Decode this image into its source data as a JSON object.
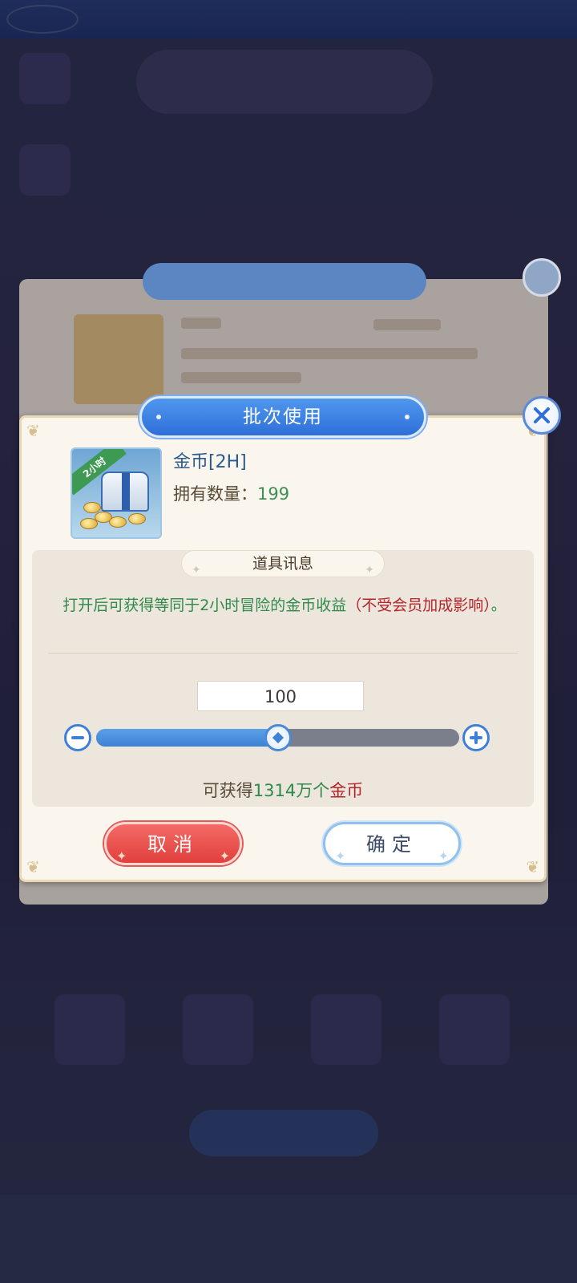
{
  "dialog": {
    "title": "批次使用",
    "item_name": "金币[2H]",
    "count_label": "拥有数量：",
    "count_value": "199",
    "item_badge": "2小时",
    "info_header": "道具讯息",
    "description_green": "打开后可获得等同于2小时冒险的金币收益",
    "description_red": "（不受会员加成影响）",
    "description_end": "。",
    "quantity": "100",
    "slider_fraction": 0.5,
    "gain_prefix": "可获得",
    "gain_amount": "1314万个",
    "gain_unit": "金币",
    "cancel_label": "取消",
    "confirm_label": "确定"
  },
  "icons": {
    "close": "close-icon",
    "minus": "minus-icon",
    "plus": "plus-icon",
    "slider_thumb": "diamond-icon"
  },
  "colors": {
    "title_blue": "#2f6fd8",
    "text_green": "#2e8a4a",
    "text_red": "#b6242a",
    "cancel_red": "#e0403d"
  }
}
